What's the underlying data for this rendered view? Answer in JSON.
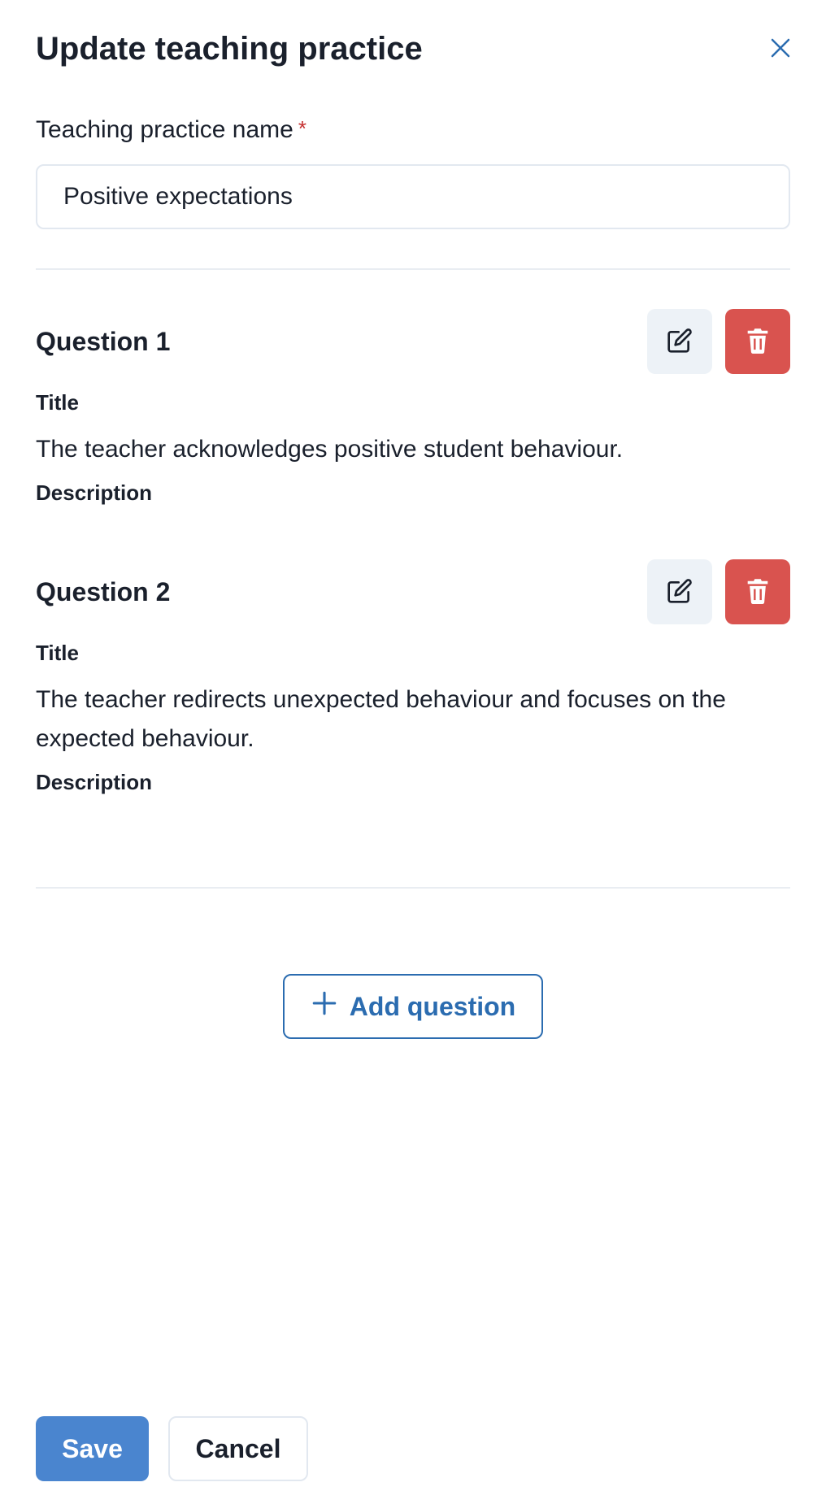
{
  "modal": {
    "title": "Update teaching practice",
    "close_icon": "close-icon"
  },
  "form": {
    "name_label": "Teaching practice name",
    "required_marker": "*",
    "name_value": "Positive expectations"
  },
  "questions": [
    {
      "heading": "Question 1",
      "title_label": "Title",
      "title": "The teacher acknowledges positive student behaviour.",
      "description_label": "Description",
      "edit_icon": "edit-icon",
      "delete_icon": "trash-icon"
    },
    {
      "heading": "Question 2",
      "title_label": "Title",
      "title": "The teacher redirects unexpected behaviour and focuses on the expected behaviour.",
      "description_label": "Description",
      "edit_icon": "edit-icon",
      "delete_icon": "trash-icon"
    }
  ],
  "actions": {
    "add_question_label": "Add question",
    "add_icon": "plus-icon",
    "save_label": "Save",
    "cancel_label": "Cancel"
  },
  "colors": {
    "accent": "#2b6cb0",
    "primary_button": "#4a85cf",
    "danger": "#d9534f",
    "required": "#c53030"
  }
}
